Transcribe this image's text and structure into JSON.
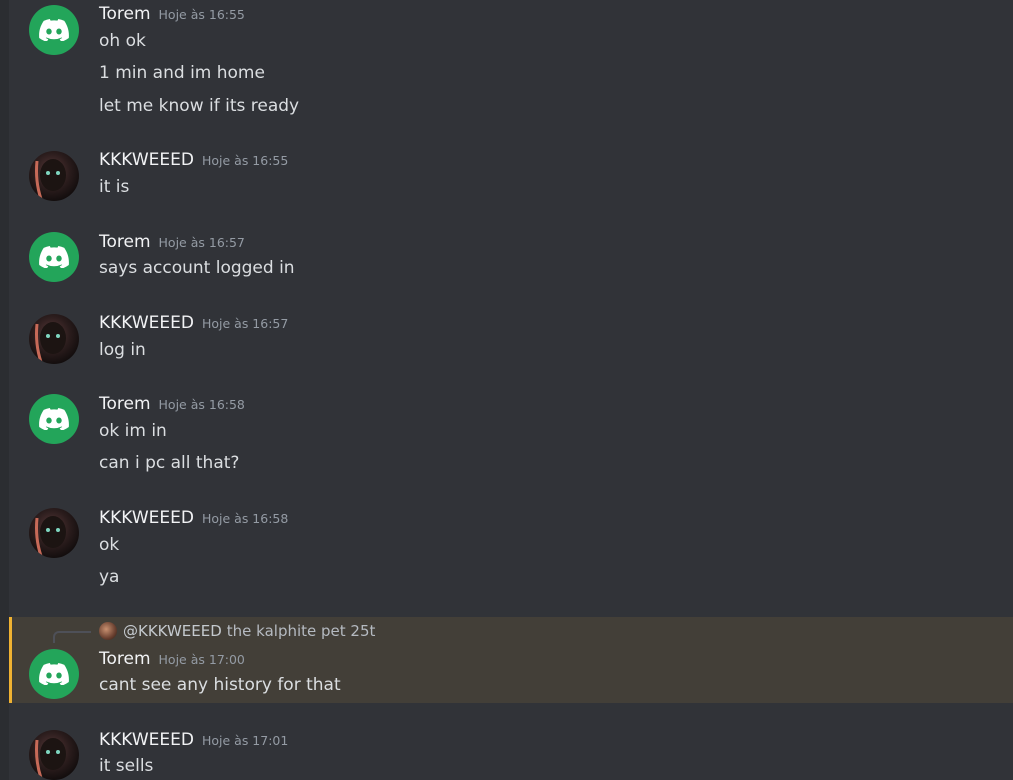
{
  "messages": [
    {
      "author": "Torem",
      "time": "Hoje às 16:55",
      "avatar": "discord-logo",
      "lines": [
        "oh ok",
        "1 min and im home",
        "let me know if its ready"
      ]
    },
    {
      "author": "KKKWEEED",
      "time": "Hoje às 16:55",
      "avatar": "user-photo",
      "lines": [
        "it is"
      ]
    },
    {
      "author": "Torem",
      "time": "Hoje às 16:57",
      "avatar": "discord-logo",
      "lines": [
        "says account logged in"
      ]
    },
    {
      "author": "KKKWEEED",
      "time": "Hoje às 16:57",
      "avatar": "user-photo",
      "lines": [
        "log in"
      ]
    },
    {
      "author": "Torem",
      "time": "Hoje às 16:58",
      "avatar": "discord-logo",
      "lines": [
        "ok im in",
        "can i pc all that?"
      ]
    },
    {
      "author": "KKKWEEED",
      "time": "Hoje às 16:58",
      "avatar": "user-photo",
      "lines": [
        "ok",
        "ya"
      ]
    },
    {
      "author": "Torem",
      "time": "Hoje às 17:00",
      "avatar": "discord-logo",
      "lines": [
        "cant see any history for that"
      ],
      "reply": {
        "user": "@KKKWEEED",
        "text": "the kalphite pet 25t"
      }
    },
    {
      "author": "KKKWEEED",
      "time": "Hoje às 17:01",
      "avatar": "user-photo",
      "lines": [
        "it sells"
      ]
    }
  ],
  "colors": {
    "background": "#313338",
    "discord_green": "#23a55a",
    "mention_highlight": "#433f38",
    "mention_bar": "#f0b232"
  }
}
